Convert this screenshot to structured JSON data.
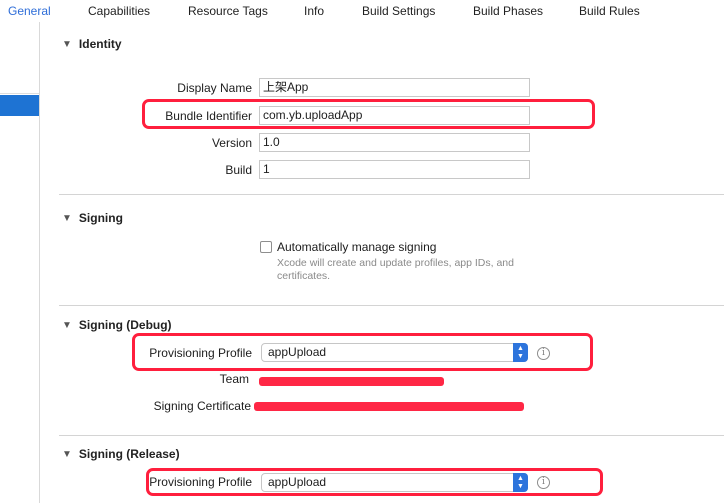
{
  "tabs": [
    {
      "label": "General"
    },
    {
      "label": "Capabilities"
    },
    {
      "label": "Resource Tags"
    },
    {
      "label": "Info"
    },
    {
      "label": "Build Settings"
    },
    {
      "label": "Build Phases"
    },
    {
      "label": "Build Rules"
    }
  ],
  "identity": {
    "title": "Identity",
    "display_name_label": "Display Name",
    "display_name_value": "上架App",
    "bundle_id_label": "Bundle Identifier",
    "bundle_id_value": "com.yb.uploadApp",
    "version_label": "Version",
    "version_value": "1.0",
    "build_label": "Build",
    "build_value": "1"
  },
  "signing": {
    "title": "Signing",
    "auto_manage_label": "Automatically manage signing",
    "auto_manage_checked": false,
    "hint": "Xcode will create and update profiles, app IDs, and certificates."
  },
  "signing_debug": {
    "title": "Signing (Debug)",
    "profile_label": "Provisioning Profile",
    "profile_value": "appUpload",
    "team_label": "Team",
    "cert_label": "Signing Certificate"
  },
  "signing_release": {
    "title": "Signing (Release)",
    "profile_label": "Provisioning Profile",
    "profile_value": "appUpload"
  },
  "colors": {
    "accent": "#1e73d3",
    "highlight": "#ff1f3d",
    "redaction": "#ff2745"
  },
  "icons": [
    "disclosure-triangle-icon",
    "popup-stepper-icon",
    "info-icon"
  ]
}
